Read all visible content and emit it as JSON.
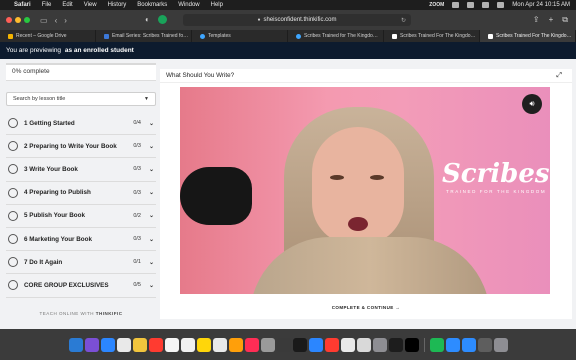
{
  "menubar": {
    "app": "Safari",
    "items": [
      "File",
      "Edit",
      "View",
      "History",
      "Bookmarks",
      "Window",
      "Help"
    ],
    "zoom": "ZOOM",
    "datetime": "Mon Apr 24  10:15 AM"
  },
  "browser": {
    "url": "sheisconfident.thinkific.com",
    "tabs": [
      {
        "label": "Recent – Google Drive",
        "color": "#f4b400"
      },
      {
        "label": "Email Series: Scribes Trained fo…",
        "color": "#3c78d8"
      },
      {
        "label": "Templates",
        "color": "#3ea6ff"
      },
      {
        "label": "Scribes Trained for The Kingdo…",
        "color": "#3ea6ff"
      },
      {
        "label": "Scribes Trained For The Kingdo…",
        "color": "#ffffff"
      },
      {
        "label": "Scribes Trained For The Kingdo…",
        "color": "#ffffff"
      }
    ]
  },
  "banner": {
    "prefix": "You are previewing",
    "emphasis": "as an enrolled student"
  },
  "sidebar": {
    "progress": "0% complete",
    "progress_value": 0,
    "search_label": "Search by lesson title",
    "chapters": [
      {
        "title": "1 Getting Started",
        "count": "0/4"
      },
      {
        "title": "2 Preparing to Write Your Book",
        "count": "0/3"
      },
      {
        "title": "3 Write Your Book",
        "count": "0/3"
      },
      {
        "title": "4 Preparing to Publish",
        "count": "0/3"
      },
      {
        "title": "5 Publish Your Book",
        "count": "0/2"
      },
      {
        "title": "6 Marketing Your Book",
        "count": "0/3"
      },
      {
        "title": "7 Do It Again",
        "count": "0/1"
      },
      {
        "title": "CORE GROUP EXCLUSIVES",
        "count": "0/5"
      }
    ],
    "footer_prefix": "TEACH ONLINE WITH",
    "footer_brand": "THINKIFIC"
  },
  "lesson": {
    "title": "What Should You Write?",
    "video_brand": "Scribes",
    "video_brand_sub": "TRAINED FOR THE KINGDOM",
    "complete_label": "COMPLETE & CONTINUE",
    "complete_arrow": "→"
  },
  "dock": {
    "apps": [
      "#2a7bd4",
      "#7b4fd6",
      "#2b86ff",
      "#e9e9e9",
      "#f2c53d",
      "#ff3b30",
      "#f5f5f5",
      "#f0f0f0",
      "#ffd60a",
      "#e9e9e9",
      "#ff9f0a",
      "#ff2d55",
      "#9a9a9a",
      "#3a3a3a",
      "#1a1a1a",
      "#2b86ff",
      "#ff3b30",
      "#e9e9e9",
      "#d9d9d9",
      "#8e8e93",
      "#1d1d1d",
      "#000000",
      "#1db954",
      "#2d8cff",
      "#2d8cff",
      "#5e5e5e",
      "#8e8e93"
    ]
  }
}
